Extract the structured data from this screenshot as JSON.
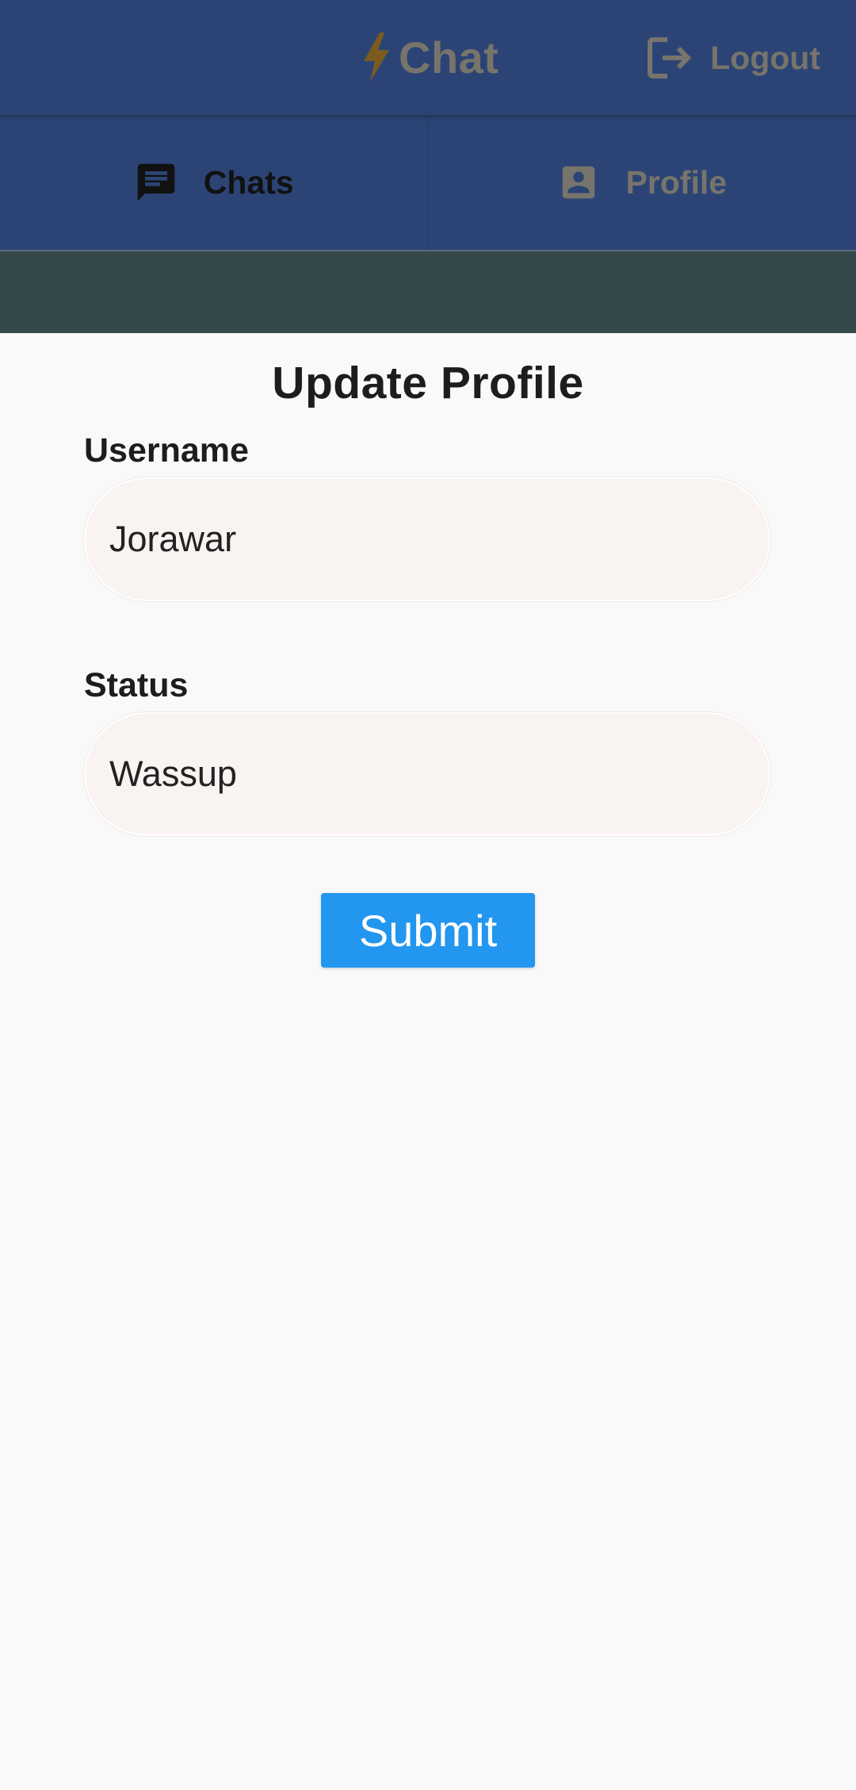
{
  "app_bar": {
    "title": "Chat",
    "title_icon": "bolt-icon",
    "logout_label": "Logout",
    "logout_icon": "logout-icon",
    "color": "#2c4475"
  },
  "tabs": [
    {
      "label": "Chats",
      "icon": "chat-icon",
      "selected": true
    },
    {
      "label": "Profile",
      "icon": "account-box-icon",
      "selected": false
    }
  ],
  "form": {
    "title": "Update Profile",
    "username_label": "Username",
    "username_value": "Jorawar",
    "status_label": "Status",
    "status_value": "Wassup",
    "submit_label": "Submit",
    "submit_color": "#2396ef"
  }
}
